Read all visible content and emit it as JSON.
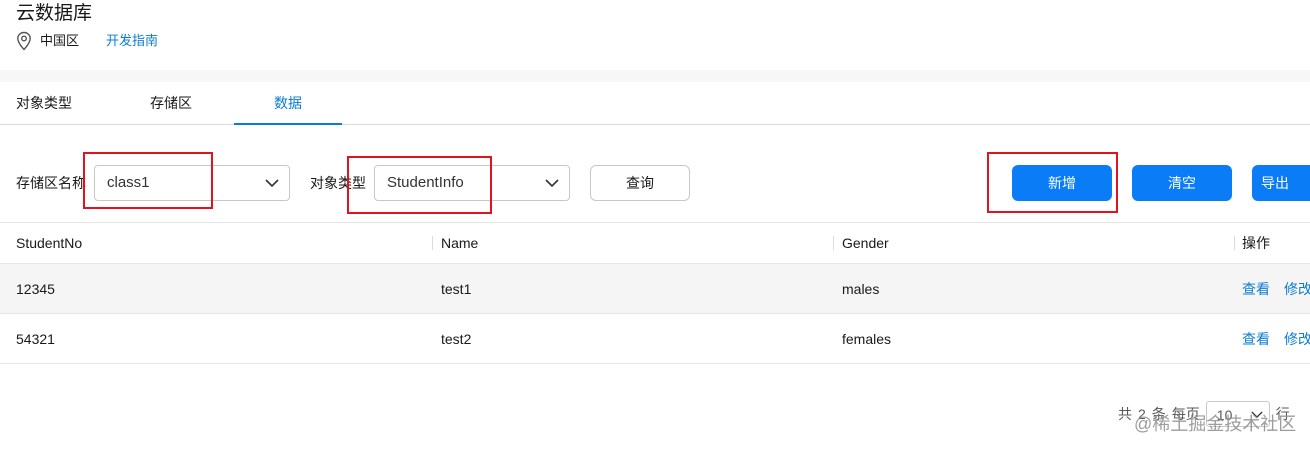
{
  "header": {
    "title": "云数据库",
    "region_icon": "location-pin-icon",
    "region": "中国区",
    "dev_guide": "开发指南"
  },
  "tabs": [
    {
      "label": "对象类型",
      "active": false
    },
    {
      "label": "存储区",
      "active": false
    },
    {
      "label": "数据",
      "active": true
    }
  ],
  "filters": {
    "zone_label": "存储区名称",
    "zone_value": "class1",
    "type_label": "对象类型",
    "type_value": "StudentInfo",
    "query_button": "查询"
  },
  "actions": {
    "add": "新增",
    "clear": "清空",
    "export": "导出"
  },
  "table": {
    "columns": [
      "StudentNo",
      "Name",
      "Gender",
      "操作"
    ],
    "rows": [
      {
        "no": "12345",
        "name": "test1",
        "gender": "males",
        "view": "查看",
        "edit": "修改"
      },
      {
        "no": "54321",
        "name": "test2",
        "gender": "females",
        "view": "查看",
        "edit": "修改"
      }
    ]
  },
  "pagination": {
    "total_prefix": "共",
    "total": "2",
    "total_unit": "条",
    "per_page_label": "每页",
    "page_size": "10",
    "page_size_unit": "行"
  },
  "watermark": "@稀土掘金技术社区",
  "colors": {
    "accent": "#0a7cf5",
    "link": "#0a7cd6",
    "highlight_box": "#e0141e"
  }
}
